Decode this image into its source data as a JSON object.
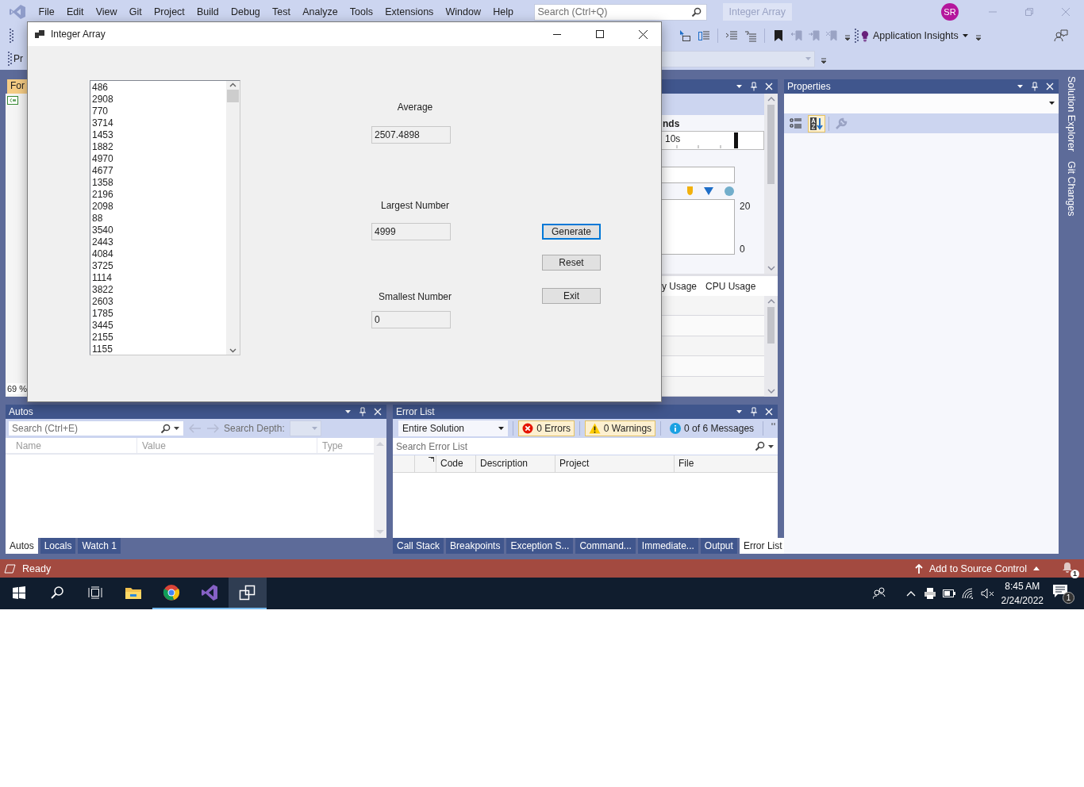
{
  "menu_bar": {
    "items": [
      "File",
      "Edit",
      "View",
      "Git",
      "Project",
      "Build",
      "Debug",
      "Test",
      "Analyze",
      "Tools",
      "Extensions",
      "Window",
      "Help"
    ],
    "search": {
      "placeholder": "Search (Ctrl+Q)"
    },
    "solution_title": "Integer Array",
    "account_initials": "SR"
  },
  "toolbar": {
    "cut_text": "Pr",
    "app_insights": "Application Insights"
  },
  "document": {
    "tab": "For",
    "zoom": "69 %"
  },
  "diagnostics": {
    "heading": "nds",
    "timeline_label": "10s",
    "axis_max": "20",
    "axis_min": "0",
    "tabs": [
      "y Usage",
      "CPU Usage"
    ]
  },
  "properties": {
    "title": "Properties",
    "tools": [
      {
        "kind": "categorized",
        "selected": false
      },
      {
        "kind": "alphabetical",
        "selected": true
      },
      {
        "kind": "property-pages",
        "selected": false
      }
    ]
  },
  "side_tabs": [
    "Solution Explorer",
    "Git Changes"
  ],
  "autos": {
    "title": "Autos",
    "search": {
      "placeholder": "Search (Ctrl+E)"
    },
    "depth_label": "Search Depth:",
    "columns": [
      "Name",
      "Value",
      "Type"
    ],
    "tabs": [
      {
        "label": "Autos",
        "selected": true
      },
      {
        "label": "Locals",
        "selected": false
      },
      {
        "label": "Watch 1",
        "selected": false
      }
    ]
  },
  "error_list": {
    "title": "Error List",
    "scope": "Entire Solution",
    "filters": [
      {
        "kind": "error",
        "label": "0 Errors",
        "on": true
      },
      {
        "kind": "warning",
        "label": "0 Warnings",
        "on": true
      },
      {
        "kind": "message",
        "label": "0 of 6 Messages",
        "on": false
      }
    ],
    "search": {
      "placeholder": "Search Error List"
    },
    "columns": [
      "Code",
      "Description",
      "Project",
      "File"
    ],
    "tabs": [
      {
        "label": "Call Stack",
        "selected": false
      },
      {
        "label": "Breakpoints",
        "selected": false
      },
      {
        "label": "Exception S...",
        "selected": false
      },
      {
        "label": "Command...",
        "selected": false
      },
      {
        "label": "Immediate...",
        "selected": false
      },
      {
        "label": "Output",
        "selected": false
      },
      {
        "label": "Error List",
        "selected": true
      }
    ]
  },
  "status_bar": {
    "text": "Ready",
    "source_control": "Add to Source Control",
    "notifications": "1"
  },
  "taskbar": {
    "apps": [
      {
        "kind": "file-explorer",
        "running": false,
        "selected": false
      },
      {
        "kind": "browser",
        "running": true,
        "selected": false
      },
      {
        "kind": "visual-studio",
        "running": true,
        "selected": false
      },
      {
        "kind": "app-window",
        "running": true,
        "selected": true
      }
    ],
    "time": "8:45 AM",
    "date": "2/24/2022",
    "notifications": "1"
  },
  "dialog": {
    "title": "Integer Array",
    "numbers": [
      "486",
      "2908",
      "770",
      "3714",
      "1453",
      "1882",
      "4970",
      "4677",
      "1358",
      "2196",
      "2098",
      "88",
      "3540",
      "2443",
      "4084",
      "3725",
      "1114",
      "3822",
      "2603",
      "1785",
      "3445",
      "2155",
      "1155"
    ],
    "fields": [
      {
        "label": "Average",
        "value": "2507.4898"
      },
      {
        "label": "Largest Number",
        "value": "4999"
      },
      {
        "label": "Smallest Number",
        "value": "0"
      }
    ],
    "buttons": [
      {
        "label": "Generate",
        "focused": true
      },
      {
        "label": "Reset",
        "focused": false
      },
      {
        "label": "Exit",
        "focused": false
      }
    ]
  }
}
